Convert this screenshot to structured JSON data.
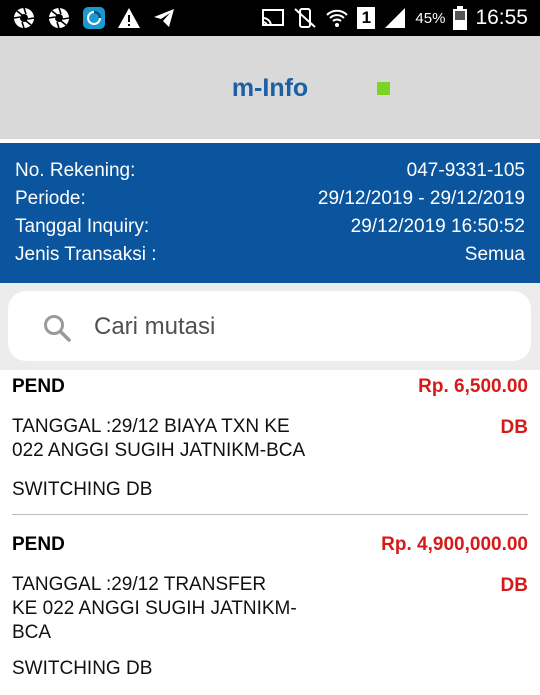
{
  "status_bar": {
    "icons_left": [
      "aperture-icon",
      "aperture-icon",
      "app-icon",
      "warning-icon",
      "send-icon"
    ],
    "icons_right": [
      "cast-icon",
      "mute-vibrate-icon",
      "wifi-icon",
      "sim-icon",
      "signal-icon"
    ],
    "sim_label": "1",
    "battery": "45%",
    "time": "16:55"
  },
  "header": {
    "title": "m-Info",
    "status_color": "#7bd425"
  },
  "account": {
    "rows": [
      {
        "label": "No. Rekening:",
        "value": "047-9331-105"
      },
      {
        "label": "Periode:",
        "value": "29/12/2019 - 29/12/2019"
      },
      {
        "label": "Tanggal Inquiry:",
        "value": "29/12/2019 16:50:52"
      },
      {
        "label": "Jenis Transaksi :",
        "value": "Semua"
      }
    ]
  },
  "search": {
    "placeholder": "Cari mutasi"
  },
  "transactions": [
    {
      "type": "PEND",
      "amount": "Rp. 6,500.00",
      "description": "TANGGAL :29/12    BIAYA TXN  KE\n022 ANGGI SUGIH JATNIKM-BCA",
      "dc": "DB",
      "code": "SWITCHING DB"
    },
    {
      "type": "PEND",
      "amount": "Rp. 4,900,000.00",
      "description": "TANGGAL :29/12    TRANSFER\nKE 022 ANGGI SUGIH JATNIKM-\nBCA",
      "dc": "DB",
      "code": "SWITCHING DB"
    }
  ],
  "colors": {
    "header_bg": "#d9d9d9",
    "title": "#1b5fa5",
    "panel_bg": "#0b559e",
    "amount": "#d61a1a"
  }
}
